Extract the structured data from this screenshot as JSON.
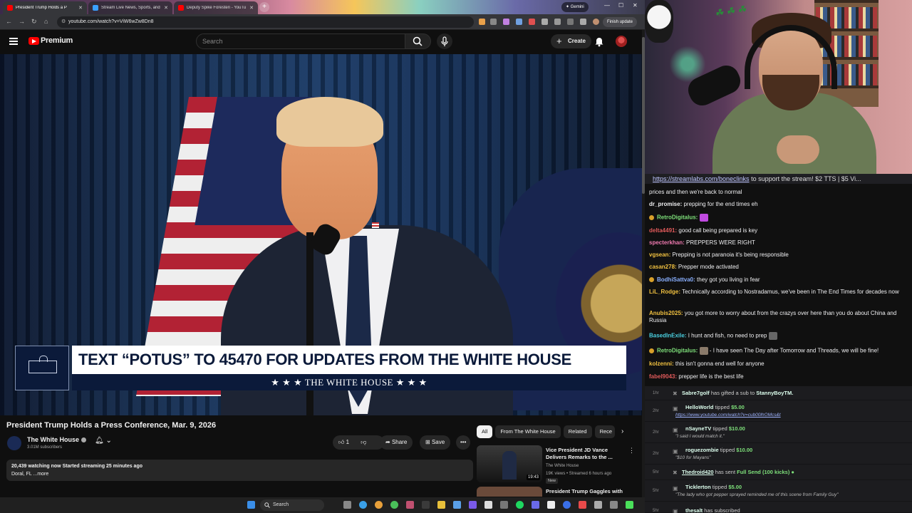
{
  "browser": {
    "tabs": [
      {
        "title": "President Trump Holds a P",
        "active": true
      },
      {
        "title": "Stream Live News, Sports, and",
        "active": false
      },
      {
        "title": "Deputy Spike Foresten - YouTu",
        "active": false
      }
    ],
    "gemini_label": "Gemini",
    "url": "youtube.com/watch?v=ViW6wZw8Dn8",
    "finish_update": "Finish update"
  },
  "youtube": {
    "logo_text": "Premium",
    "search_placeholder": "Search",
    "create_label": "Create",
    "video": {
      "chyron_main": "TEXT “POTUS” TO 45470 FOR UPDATES FROM THE WHITE HOUSE",
      "chyron_sub": "★ ★ ★   THE WHITE HOUSE   ★ ★ ★",
      "title": "President Trump Holds a Press Conference, Mar. 9, 2026"
    },
    "channel": {
      "name": "The White House",
      "subscribers": "3.01M subscribers"
    },
    "actions": {
      "likes": "1",
      "share": "Share",
      "save": "Save",
      "more": "•••"
    },
    "description": {
      "stats": "20,439 watching now  Started streaming 25 minutes ago",
      "location": "Doral, FL",
      "more": "...more"
    },
    "chips": [
      "All",
      "From The White House",
      "Related",
      "Rece"
    ],
    "recommendations": [
      {
        "title": "Vice President JD Vance Delivers Remarks to the ...",
        "channel": "The White House",
        "meta": "19K views • Streamed 6 hours ago",
        "badge": "New",
        "duration": "19:43"
      },
      {
        "title": "President Trump Gaggles with"
      }
    ]
  },
  "stream_chat": {
    "pinned": {
      "link": "https://streamlabs.com/boneclinks",
      "text": " to support the stream! $2 TTS | $5 Vi..."
    },
    "messages": [
      {
        "user": "",
        "text": "prices and then we're back to normal",
        "color": "#efeff1"
      },
      {
        "user": "dr_promise:",
        "text": " prepping for the end times eh",
        "color": "#efeff1"
      },
      {
        "user": "RetroDigitalus:",
        "text": "",
        "color": "#7ee07a"
      },
      {
        "user": "delta4491:",
        "text": " good call being prepared is key",
        "color": "#e05a5a"
      },
      {
        "user": "specterkhan:",
        "text": " PREPPERS WERE RIGHT",
        "color": "#f07ab0"
      },
      {
        "user": "vgsean:",
        "text": " Prepping is not paranoia it's being responsible",
        "color": "#f0c040"
      },
      {
        "user": "casan278:",
        "text": " Prepper mode activated",
        "color": "#f0c040"
      },
      {
        "user": "BodhiSattva0:",
        "text": " they got you living in fear",
        "color": "#8ab0ff"
      },
      {
        "user": "LiL_Rodge:",
        "text": " Technically according to Nostradamus, we've been in The End Times for decades now",
        "color": "#f0c040"
      },
      {
        "user": "Anubis2025:",
        "text": " you got more to worry about from the crazys over here than you do about China and Russia",
        "color": "#f0c040"
      },
      {
        "user": "BasedInExile:",
        "text": " I hunt and fish, no need to prep",
        "color": "#4ad0e0"
      },
      {
        "user": "RetroDigitalus:",
        "text": "  - I have seen The Day after Tomorrow and Threads, we will be fine!",
        "color": "#7ee07a"
      },
      {
        "user": "kolzenni:",
        "text": " this isn't gonna end well for anyone",
        "color": "#f0c040"
      },
      {
        "user": "fabel9043:",
        "text": " prepper life is the best life",
        "color": "#e05a5a"
      }
    ]
  },
  "activity_feed": [
    {
      "time": "1hr",
      "line1_user": "Sabre7golf",
      "line1_text": " has gifted a sub to ",
      "line1_target": "StannyBoyTM.",
      "line2": ""
    },
    {
      "time": "2hr",
      "line1_user": "HelloWorld",
      "line1_text": " tipped ",
      "line1_amount": "$5.00",
      "line2": "https://www.youtube.com/watch?v=cub00lhOMcs&t",
      "line2_link": true
    },
    {
      "time": "2hr",
      "line1_user": "nSayneTV",
      "line1_text": " tipped ",
      "line1_amount": "$10.00",
      "line2": "\"I said I would match it.\""
    },
    {
      "time": "2hr",
      "line1_user": "roguezombie",
      "line1_text": " tipped ",
      "line1_amount": "$10.00",
      "line2": "\"$10 for Mayans\""
    },
    {
      "time": "5hr",
      "line1_user": "Thedroid420",
      "line1_text": " has sent ",
      "line1_amount": "Full Send (100 kicks)",
      "line2": ""
    },
    {
      "time": "5hr",
      "line1_user": "Ticklerton",
      "line1_text": " tipped ",
      "line1_amount": "$5.00",
      "line2": "\"The lady who got pepper sprayed reminded me of this scene from Family Guy\""
    },
    {
      "time": "5hr",
      "line1_user": "thesalt",
      "line1_text": " has subscribed",
      "line2": ""
    }
  ],
  "taskbar": {
    "search": "Search"
  },
  "colors": {
    "youtube_red": "#ff0000",
    "tip_green": "#7ee07a",
    "chyron_navy": "#0b1a3a"
  }
}
